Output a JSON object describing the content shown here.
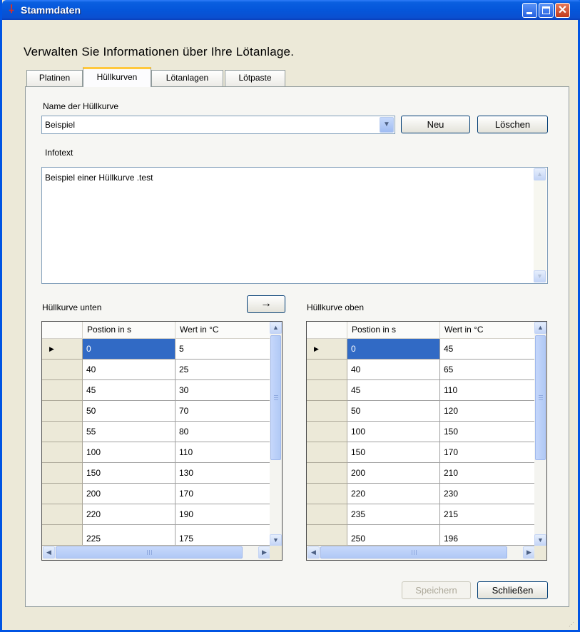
{
  "window": {
    "title": "Stammdaten",
    "app_icon": "solder-iron-icon",
    "buttons": [
      "minimize-icon",
      "maximize-icon",
      "close-icon"
    ]
  },
  "subtitle": "Verwalten Sie Informationen über Ihre Lötanlage.",
  "tabs": [
    {
      "label": "Platinen",
      "active": false
    },
    {
      "label": "Hüllkurven",
      "active": true
    },
    {
      "label": "Lötanlagen",
      "active": false
    },
    {
      "label": "Lötpaste",
      "active": false
    }
  ],
  "form": {
    "name_label": "Name der Hüllkurve",
    "name_value": "Beispiel",
    "new_button": "Neu",
    "delete_button": "Löschen",
    "info_label": "Infotext",
    "info_value": "Beispiel einer Hüllkurve .test",
    "copy_arrow": "→"
  },
  "lower": {
    "label": "Hüllkurve unten",
    "columns": [
      "Postion in s",
      "Wert in °C"
    ],
    "rows": [
      [
        "0",
        "5"
      ],
      [
        "40",
        "25"
      ],
      [
        "45",
        "30"
      ],
      [
        "50",
        "70"
      ],
      [
        "55",
        "80"
      ],
      [
        "100",
        "110"
      ],
      [
        "150",
        "130"
      ],
      [
        "200",
        "170"
      ],
      [
        "220",
        "190"
      ],
      [
        "225",
        "175"
      ]
    ]
  },
  "upper": {
    "label": "Hüllkurve oben",
    "columns": [
      "Postion in s",
      "Wert in °C"
    ],
    "rows": [
      [
        "0",
        "45"
      ],
      [
        "40",
        "65"
      ],
      [
        "45",
        "110"
      ],
      [
        "50",
        "120"
      ],
      [
        "100",
        "150"
      ],
      [
        "150",
        "170"
      ],
      [
        "200",
        "210"
      ],
      [
        "220",
        "230"
      ],
      [
        "235",
        "215"
      ],
      [
        "250",
        "196"
      ]
    ]
  },
  "footer": {
    "save_button": "Speichern",
    "close_button": "Schließen"
  },
  "colors": {
    "title_bar": "#0556da",
    "selection": "#316ac5",
    "active_tab_accent": "#ffc83c"
  }
}
